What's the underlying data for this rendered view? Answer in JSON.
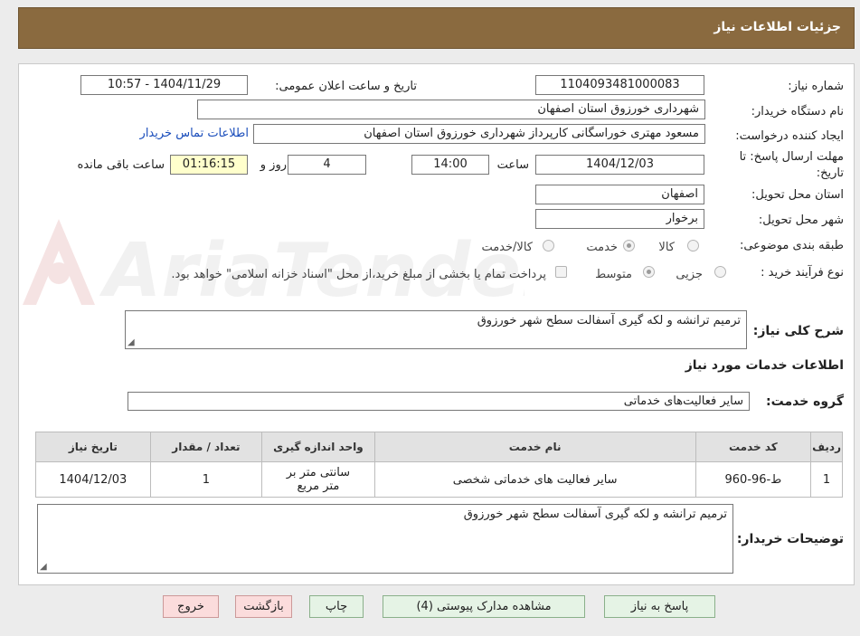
{
  "header": {
    "title": "جزئیات اطلاعات نیاز"
  },
  "form": {
    "need_number_label": "شماره نیاز:",
    "need_number": "1104093481000083",
    "announce_label": "تاریخ و ساعت اعلان عمومی:",
    "announce_value": "1404/11/29 - 10:57",
    "buyer_org_label": "نام دستگاه خریدار:",
    "buyer_org": "شهرداری خورزوق استان اصفهان",
    "creator_label": "ایجاد کننده درخواست:",
    "creator": "مسعود مهتری خوراسگانی کارپرداز شهرداری خورزوق استان اصفهان",
    "contact_link": "اطلاعات تماس خریدار",
    "deadline_label_1": "مهلت ارسال پاسخ: تا",
    "deadline_label_2": "تاریخ:",
    "deadline_date": "1404/12/03",
    "time_label": "ساعت",
    "deadline_time": "14:00",
    "days_value": "4",
    "days_label": "روز و",
    "remaining_time": "01:16:15",
    "remaining_label": "ساعت باقی مانده",
    "province_label": "استان محل تحویل:",
    "province": "اصفهان",
    "city_label": "شهر محل تحویل:",
    "city": "برخوار",
    "category_label": "طبقه بندی موضوعی:",
    "category_options": [
      "کالا",
      "خدمت",
      "کالا/خدمت"
    ],
    "category_selected": "خدمت",
    "process_label": "نوع فرآیند خرید :",
    "process_options": [
      "جزیی",
      "متوسط"
    ],
    "process_selected": "متوسط",
    "payment_note": "پرداخت تمام یا بخشی از مبلغ خرید،از محل \"اسناد خزانه اسلامی\" خواهد بود.",
    "summary_label": "شرح کلی نیاز:",
    "summary": "ترمیم ترانشه و لکه گیری آسفالت سطح شهر خورزوق",
    "services_title": "اطلاعات خدمات مورد نیاز",
    "service_group_label": "گروه خدمت:",
    "service_group": "سایر فعالیت‌های خدماتی",
    "buyer_notes_label": "توضیحات خریدار:",
    "buyer_notes": "ترمیم ترانشه و لکه گیری آسفالت سطح شهر خورزوق"
  },
  "table": {
    "headers": [
      "ردیف",
      "کد خدمت",
      "نام خدمت",
      "واحد اندازه گیری",
      "تعداد / مقدار",
      "تاریخ نیاز"
    ],
    "rows": [
      [
        "1",
        "ط-96-960",
        "سایر فعالیت های خدماتی شخصی",
        "سانتی متر بر متر مربع",
        "1",
        "1404/12/03"
      ]
    ]
  },
  "buttons": {
    "reply": "پاسخ به نیاز",
    "attachments": "مشاهده مدارک پیوستی (4)",
    "print": "چاپ",
    "back": "بازگشت",
    "exit": "خروج"
  },
  "watermark": "AriaTender.neT"
}
